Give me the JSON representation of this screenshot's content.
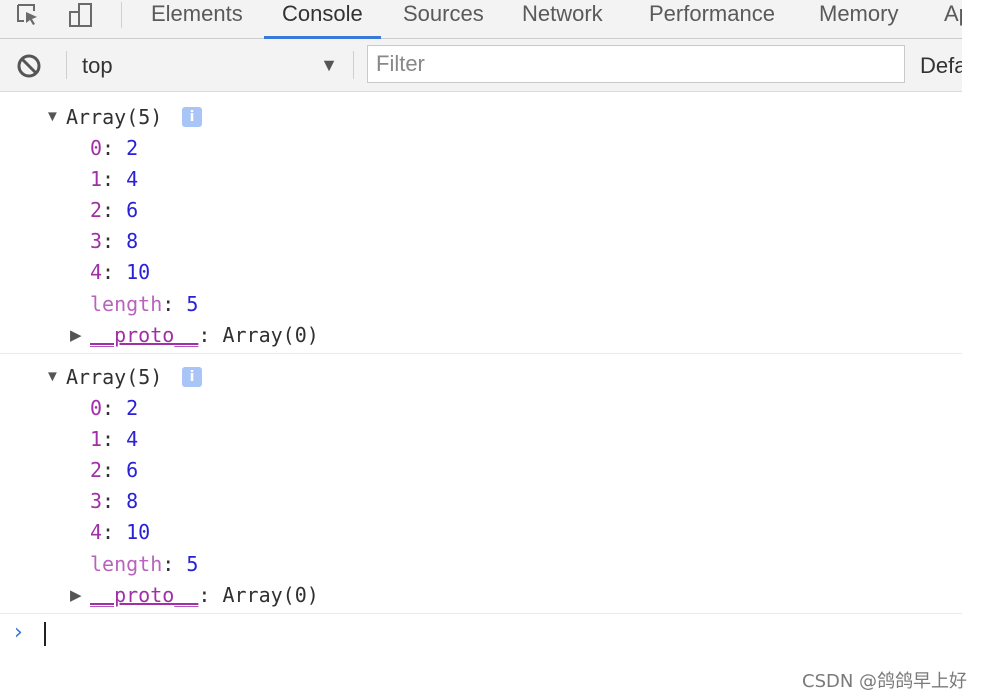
{
  "tabs": [
    {
      "label": "Elements"
    },
    {
      "label": "Console"
    },
    {
      "label": "Sources"
    },
    {
      "label": "Network"
    },
    {
      "label": "Performance"
    },
    {
      "label": "Memory"
    },
    {
      "label": "Ap"
    }
  ],
  "active_tab": "Console",
  "toolbar": {
    "context": "top",
    "filter_placeholder": "Filter",
    "levels_label": "Defa"
  },
  "messages": [
    {
      "header": "Array(5)",
      "info_icon": "i",
      "entries": [
        {
          "key": "0",
          "value": "2"
        },
        {
          "key": "1",
          "value": "4"
        },
        {
          "key": "2",
          "value": "6"
        },
        {
          "key": "3",
          "value": "8"
        },
        {
          "key": "4",
          "value": "10"
        }
      ],
      "length_key": "length",
      "length_value": "5",
      "proto_key": "__proto__",
      "proto_value": "Array(0)"
    },
    {
      "header": "Array(5)",
      "info_icon": "i",
      "entries": [
        {
          "key": "0",
          "value": "2"
        },
        {
          "key": "1",
          "value": "4"
        },
        {
          "key": "2",
          "value": "6"
        },
        {
          "key": "3",
          "value": "8"
        },
        {
          "key": "4",
          "value": "10"
        }
      ],
      "length_key": "length",
      "length_value": "5",
      "proto_key": "__proto__",
      "proto_value": "Array(0)"
    }
  ],
  "prompt_symbol": "›",
  "watermark": "CSDN @鸽鸽早上好",
  "colors": {
    "key": "#a12fa7",
    "number": "#2a20d6",
    "accent": "#3879d9"
  },
  "icons": [
    "inspect-element-icon",
    "device-toolbar-icon",
    "clear-console-icon",
    "info-icon",
    "expand-triangle-icon",
    "collapse-triangle-icon",
    "prompt-chevron-icon"
  ]
}
